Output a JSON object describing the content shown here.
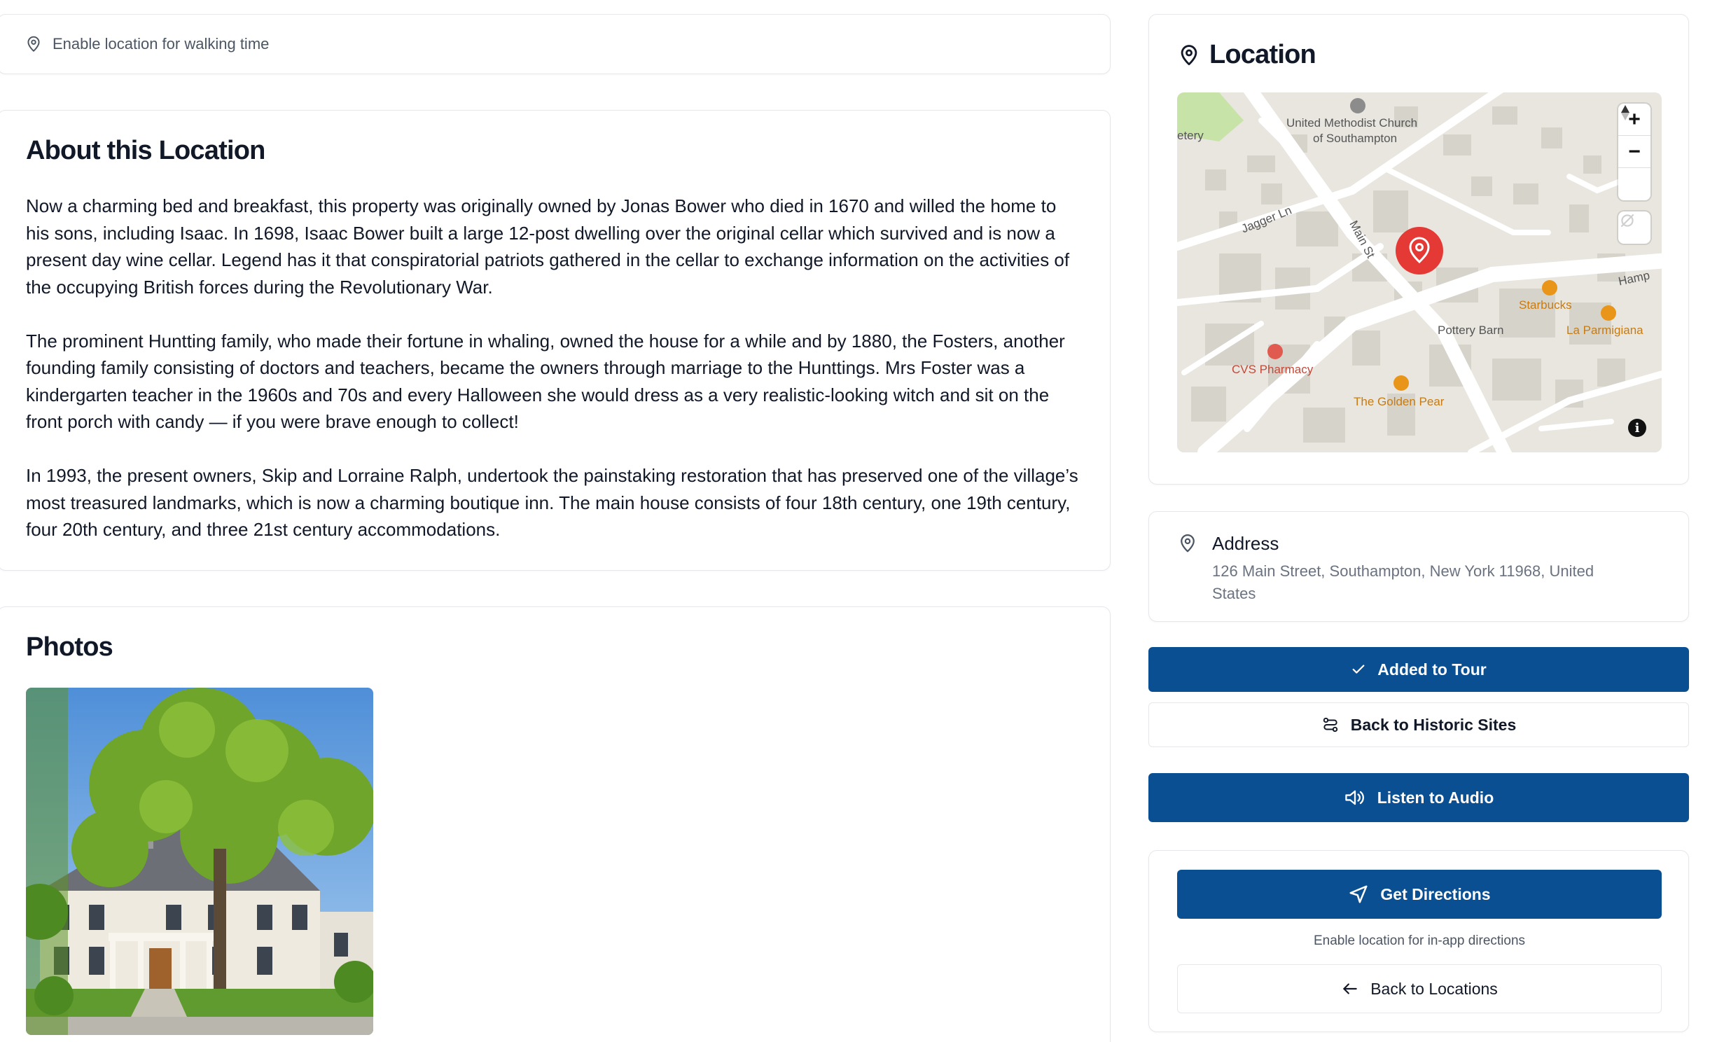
{
  "location_banner": {
    "text": "Enable location for walking time",
    "icon": "map-pin-icon"
  },
  "about": {
    "title": "About this Location",
    "paragraphs": [
      "Now a charming bed and breakfast, this property was originally owned by Jonas Bower who died in 1670 and willed the home to his sons, including Isaac. In 1698, Isaac Bower built a large 12-post dwelling over the original cellar which survived and is now a present day wine cellar. Legend has it that conspiratorial patriots gathered in the cellar to exchange information on the activities of the occupying British forces during the Revolutionary War.",
      "The prominent Huntting family, who made their fortune in whaling,  owned the house for a while and by 1880, the Fosters, another founding family consisting of doctors and teachers, became the owners through marriage to the Hunttings. Mrs Foster was a kindergarten teacher in the 1960s and 70s and every Halloween she would dress as a very realistic-looking witch and sit on the front porch with candy — if you were brave enough to collect!",
      "In 1993, the present owners, Skip and Lorraine Ralph, undertook the painstaking restoration that has preserved one of the village’s most treasured landmarks, which is now a charming boutique inn. The main house consists of four 18th century, one 19th century, four 20th century, and three 21st century accommodations."
    ]
  },
  "photos": {
    "title": "Photos"
  },
  "map_panel": {
    "title": "Location",
    "icon": "map-pin-icon",
    "labels": {
      "cemetery": "etery",
      "church_line1": "United Methodist Church",
      "church_line2": "of Southampton",
      "jagger": "Jagger Ln",
      "main_st": "Main St",
      "hampton": "Hamp",
      "starbucks": "Starbucks",
      "pottery_barn": "Pottery Barn",
      "la_parmigiana": "La Parmigiana",
      "cvs": "CVS Pharmacy",
      "golden_pear": "The Golden Pear"
    },
    "zoom_in": "+",
    "zoom_out": "−",
    "info": "i"
  },
  "address": {
    "title": "Address",
    "value": "126 Main Street, Southampton, New York 11968, United States"
  },
  "buttons": {
    "added_to_tour": "Added to Tour",
    "back_to_sites": "Back to Historic Sites",
    "listen_audio": "Listen to Audio",
    "get_directions": "Get Directions",
    "back_to_locations": "Back to Locations"
  },
  "directions_hint": "Enable location for in-app directions",
  "colors": {
    "primary": "#0b4f93",
    "marker": "#e53935",
    "map_bg": "#e8e6df",
    "poi": "#e8951a"
  }
}
